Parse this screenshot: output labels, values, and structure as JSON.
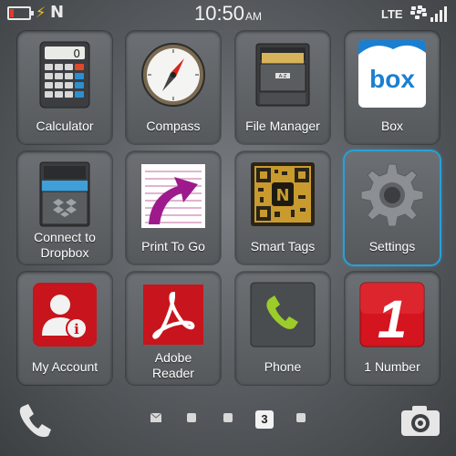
{
  "status_bar": {
    "time": "10:50",
    "ampm": "AM",
    "network": "LTE",
    "battery_color": "#e23a2e",
    "charging_icon": "lightning-bolt-icon",
    "nfc_icon": "nfc-icon"
  },
  "apps": [
    {
      "label": "Calculator",
      "icon": "calculator-icon"
    },
    {
      "label": "Compass",
      "icon": "compass-icon"
    },
    {
      "label": "File Manager",
      "icon": "file-cabinet-icon"
    },
    {
      "label": "Box",
      "icon": "box-logo-icon",
      "icon_text": "box"
    },
    {
      "label": "Connect to Dropbox",
      "line1": "Connect to",
      "line2": "Dropbox",
      "icon": "dropbox-icon"
    },
    {
      "label": "Print To Go",
      "icon": "print-to-go-icon"
    },
    {
      "label": "Smart Tags",
      "icon": "qr-nfc-tag-icon"
    },
    {
      "label": "Settings",
      "icon": "gear-icon",
      "selected": true
    },
    {
      "label": "My Account",
      "icon": "account-info-icon"
    },
    {
      "label": "Adobe Reader",
      "line1": "Adobe",
      "line2": "Reader",
      "icon": "adobe-reader-icon"
    },
    {
      "label": "Phone",
      "icon": "phone-icon"
    },
    {
      "label": "1 Number",
      "icon": "one-number-icon",
      "icon_text": "1"
    }
  ],
  "calculator_display": "0",
  "dock": {
    "phone_icon": "phone-handset-icon",
    "camera_icon": "camera-icon",
    "pages": [
      "hub",
      "1",
      "2",
      "3",
      "4"
    ],
    "active_page": "3"
  },
  "colors": {
    "selection": "#2b9fd8",
    "box_blue": "#1a7fd1",
    "adobe_red": "#c8141c",
    "account_red": "#c8141c",
    "phone_green": "#9ccc2a"
  }
}
